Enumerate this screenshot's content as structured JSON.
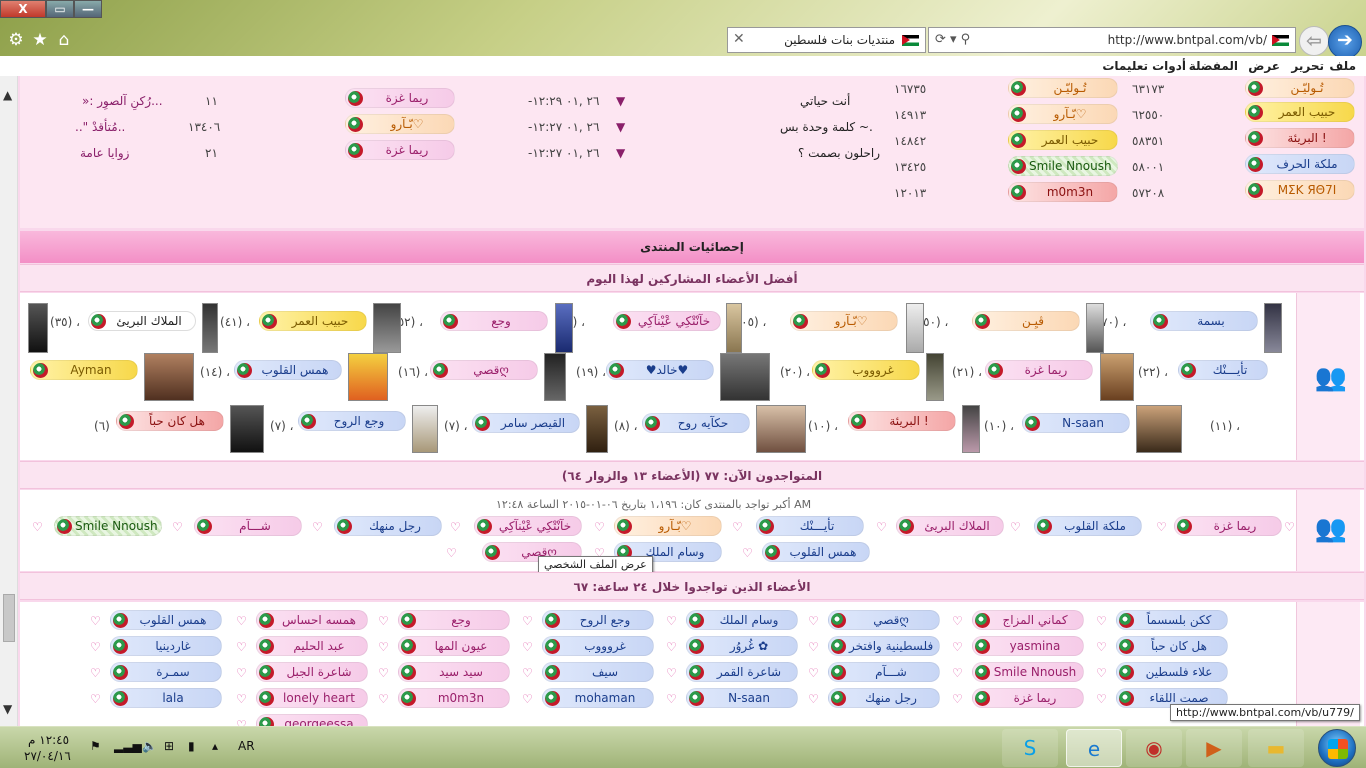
{
  "window": {
    "close": "X",
    "max": "▭",
    "min": "—"
  },
  "toolbar": {
    "icons": [
      "gear-icon",
      "star-icon",
      "home-icon"
    ],
    "url": "http://www.bntpal.com/vb/",
    "tab_title": "منتديات بنات فلسطين"
  },
  "menu": [
    "ملف",
    "تحرير",
    "عرض",
    "المفضلة",
    "أدوات",
    "تعليمات"
  ],
  "top_rows": {
    "left": [
      {
        "num": "١١",
        "title": "»: رُكنِ آلصوِر...",
        "user": "ريما غزة",
        "date": "-٢٦ ,٠١ ١٢:٢٩"
      },
      {
        "num": "١٣٤٠٦",
        "title": "..\" مُتأقدْ..",
        "user": "بّـآرو♡",
        "date": "-٢٦ ,٠١ ١٢:٢٧"
      },
      {
        "num": "٢١",
        "title": "زوايا عامة",
        "user": "ريما غزة",
        "date": "-٢٦ ,٠١ ١٢:٢٧"
      }
    ],
    "mid": [
      "أنت حياتي",
      "كلمة وحدة بس ~.",
      "راحلون بصمت ؟"
    ],
    "right": [
      {
        "count": "١٦٧٣٥",
        "user": "تُـوليّـن",
        "num": "٦٣١٧٣",
        "top": "تُـوليّـن"
      },
      {
        "count": "١٤٩١٣",
        "user": "بّـآرو♡",
        "num": "٦٢٥٥٠",
        "top": "حبيب العمر"
      },
      {
        "count": "١٤٨٤٢",
        "user": "حبيب العمر",
        "num": "٥٨٣٥١",
        "top": "البريئة !"
      },
      {
        "count": "١٣٤٢٥",
        "user": "Smile Nnoush",
        "num": "٥٨٠٠١",
        "top": "ملكة الحرف"
      },
      {
        "count": "١٢٠١٣",
        "user": "m0m3n",
        "num": "٥٧٢٠٨",
        "top": "MΣK ЯΘ7I"
      }
    ]
  },
  "stats": {
    "title": "إحصائيات المنتدى",
    "top_today_title": "أفضل الأعضاء المشاركين لهذا اليوم",
    "top_today": [
      {
        "name": "بسمة",
        "n": "(١٧٠) ،"
      },
      {
        "name": "ڤيِـن",
        "n": "(١٥٠) ،"
      },
      {
        "name": "بّـآرو♡",
        "n": "(١٠٥) ،"
      },
      {
        "name": "خآنْتْكِي عْيْنآكِي",
        "n": "(٥٥) ،"
      },
      {
        "name": "وجع",
        "n": "(٥٢) ،"
      },
      {
        "name": "حبيب العمر",
        "n": "(٤١) ،"
      },
      {
        "name": "الملاك البريئ",
        "n": "(٣٥) ،"
      },
      {
        "name": "تأْيـــنْك",
        "n": "(٢٢) ،"
      },
      {
        "name": "ريما غزة",
        "n": "(٢١) ،"
      },
      {
        "name": "غروووب",
        "n": "(٢٠) ،"
      },
      {
        "name": "♥خالد♥",
        "n": "(١٩) ،"
      },
      {
        "name": "قصيღ",
        "n": "(١٦) ،"
      },
      {
        "name": "همس القلوب",
        "n": "(١٤) ،"
      },
      {
        "name": "Ayman",
        "n": ""
      },
      {
        "name": "N-saan",
        "n": "(١١) ،"
      },
      {
        "name": "البريئة !",
        "n": "(١٠) ،"
      },
      {
        "name": "حكآيه روح",
        "n": "(١٠) ،"
      },
      {
        "name": "القيصر سامر",
        "n": "(٨) ،"
      },
      {
        "name": "وجع الروح",
        "n": "(٧) ،"
      },
      {
        "name": "هل كان حباً",
        "n": "(٧) ،"
      },
      {
        "name": "",
        "n": "(٦)"
      }
    ],
    "online_title": "المتواجدون الآن: ٧٧ (الأعضاء ١٣ والزوار ٦٤)",
    "online_record": "أكبر تواجد بالمنتدى كان: ١،١٩٦ بتاريخ ٠٦-٠١-٢٠١٥ الساعة ١٢:٤٨ AM",
    "online": [
      "ريما غزة",
      "ملكة القلوب",
      "الملاك البريئ",
      "تأْيـــنْك",
      "بّـآرو♡",
      "خآنْتْكِي عْيْنآكِي",
      "رجل منهك",
      "شـــآم",
      "Smile Nnoush",
      "همس القلوب",
      "وسام الملك",
      "قصيღ"
    ],
    "tooltip_profile": "عرض الملف الشخصي",
    "day_title": "الأعضاء الذين تواجدوا خلال ٢٤ ساعة: ٦٧",
    "day_rows": [
      [
        "ككن بلسسماً",
        "كماني المزاج",
        "قصيღ",
        "وسام الملك",
        "وجع الروح",
        "وجع",
        "همسه احساس",
        "همس القلوب"
      ],
      [
        "هل كان حباً",
        "yasmina",
        "فلسطينية وافتخر",
        "غُروُر ✿",
        "غروووب",
        "عيون المها",
        "عبد الحليم",
        "غاردينيا"
      ],
      [
        "علاء فلسطين",
        "Smile Nnoush",
        "شـــآم",
        "شاعرة القمر",
        "سيف",
        "سيد سيد",
        "شاعرة الجبل",
        "سمـرة"
      ],
      [
        "صمت اللقاء",
        "ريما غزة",
        "رجل منهك",
        "N-saan",
        "mohaman",
        "m0m3n",
        "lonely heart",
        "lala"
      ],
      [
        "",
        "",
        "",
        "",
        "",
        "",
        "georgeessa",
        ""
      ]
    ],
    "status_url": "http://www.bntpal.com/vb/u779/"
  },
  "taskbar": {
    "time": "١٢:٤٥ م",
    "date": "٢٧/٠٤/١٦",
    "lang": "AR",
    "apps": [
      "skype-icon",
      "ie-icon",
      "chrome-icon",
      "media-icon",
      "folder-icon"
    ]
  }
}
